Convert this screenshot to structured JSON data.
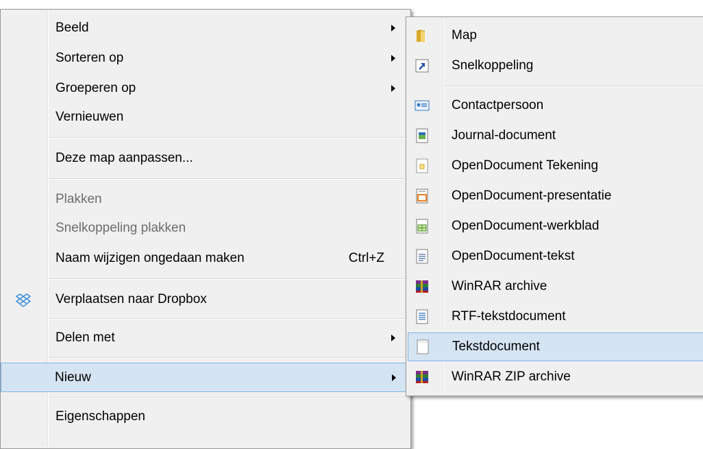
{
  "context_menu": {
    "items": [
      {
        "label": "Beeld"
      },
      {
        "label": "Sorteren op"
      },
      {
        "label": "Groeperen op"
      },
      {
        "label": "Vernieuwen"
      },
      {
        "label": "Deze map aanpassen..."
      },
      {
        "label": "Plakken"
      },
      {
        "label": "Snelkoppeling plakken"
      },
      {
        "label": "Naam wijzigen ongedaan maken",
        "shortcut": "Ctrl+Z"
      },
      {
        "label": "Verplaatsen naar Dropbox",
        "icon": "dropbox-icon"
      },
      {
        "label": "Delen met"
      },
      {
        "label": "Nieuw"
      },
      {
        "label": "Eigenschappen"
      }
    ]
  },
  "submenu_new": {
    "items": [
      {
        "label": "Map",
        "icon": "folder-icon"
      },
      {
        "label": "Snelkoppeling",
        "icon": "shortcut-icon"
      },
      {
        "label": "Contactpersoon",
        "icon": "contact-card-icon"
      },
      {
        "label": "Journal-document",
        "icon": "journal-document-icon"
      },
      {
        "label": "OpenDocument Tekening",
        "icon": "odg-drawing-icon"
      },
      {
        "label": "OpenDocument-presentatie",
        "icon": "odp-presentation-icon"
      },
      {
        "label": "OpenDocument-werkblad",
        "icon": "ods-spreadsheet-icon"
      },
      {
        "label": "OpenDocument-tekst",
        "icon": "odt-text-icon"
      },
      {
        "label": "WinRAR archive",
        "icon": "winrar-archive-icon"
      },
      {
        "label": "RTF-tekstdocument",
        "icon": "rtf-document-icon"
      },
      {
        "label": "Tekstdocument",
        "icon": "text-document-icon"
      },
      {
        "label": "WinRAR ZIP archive",
        "icon": "winrar-zip-icon"
      }
    ]
  },
  "colors": {
    "menu_background": "#f0f0f0",
    "highlight_background": "#d5e4f2",
    "highlight_border": "#7eb4ea",
    "disabled_text": "#6d6d6d"
  }
}
